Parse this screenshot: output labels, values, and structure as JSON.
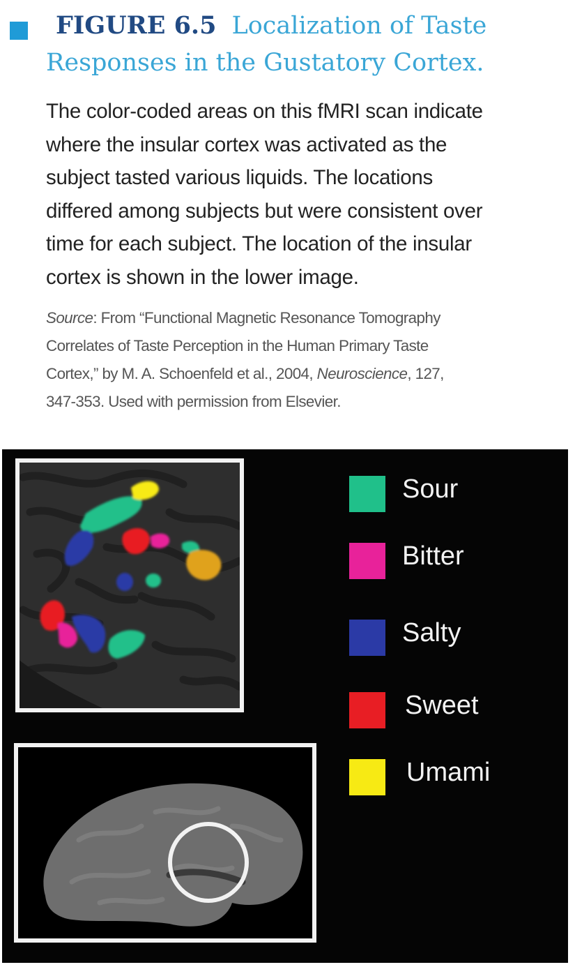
{
  "figure": {
    "label": "FIGURE 6.5",
    "title_line1": "Localization of Taste",
    "title_line2": "Responses in the Gustatory Cortex.",
    "accent_color": "#1f9bd7"
  },
  "caption": {
    "lines": [
      "The color-coded areas on this fMRI scan indicate",
      "where the insular cortex was activated as the",
      "subject tasted various liquids. The locations",
      "differed among subjects but were consistent over",
      "time for each subject. The location of the insular",
      "cortex is shown in the lower image."
    ]
  },
  "source": {
    "label": "Source",
    "line1_rest": ": From “Functional Magnetic Resonance Tomography",
    "line2": "Correlates of Taste Perception in the Human Primary Taste",
    "line3_pre": "Cortex,” by M. A. Schoenfeld et al., 2004, ",
    "journal": "Neuroscience",
    "line3_post": ", 127,",
    "line4": "347-353. Used with permission from Elsevier."
  },
  "legend": [
    {
      "label": "Sour",
      "color": "#20c08a"
    },
    {
      "label": "Bitter",
      "color": "#e8229a"
    },
    {
      "label": "Salty",
      "color": "#2b3aa6"
    },
    {
      "label": "Sweet",
      "color": "#e81e24"
    },
    {
      "label": "Umami",
      "color": "#f7ea14"
    }
  ]
}
